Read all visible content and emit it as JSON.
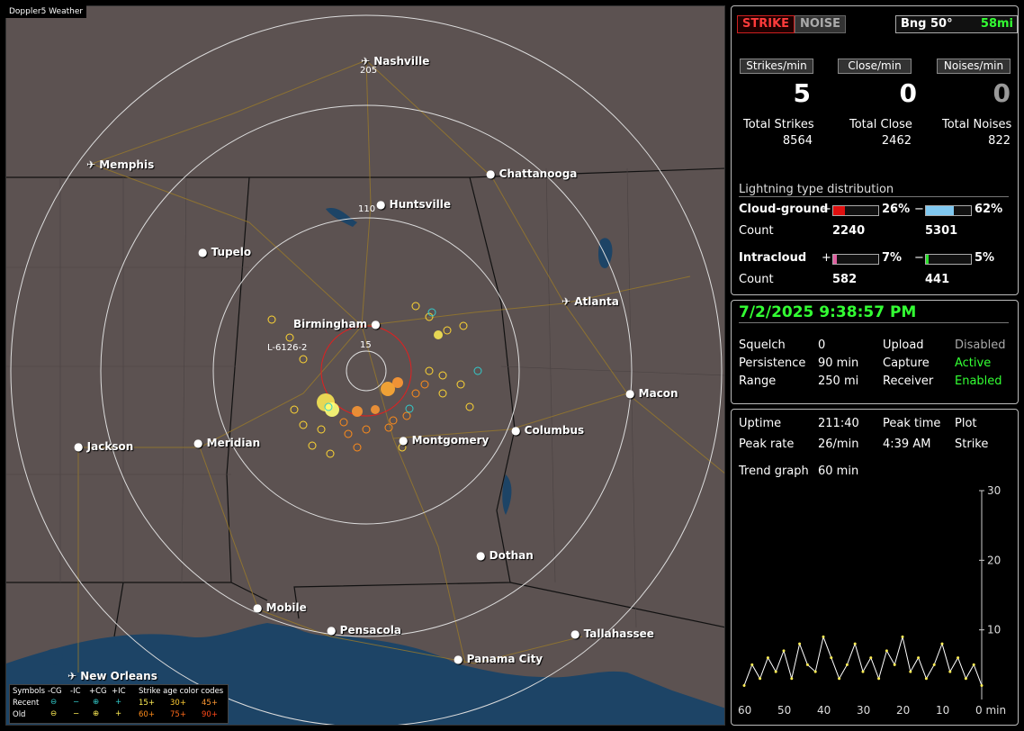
{
  "app_title": "Doppler5 Weather",
  "colors": {
    "map_bg": "#5c5251",
    "water": "#1d4466",
    "accent_green": "#33ff33",
    "strike_red": "#ff3b3b"
  },
  "map": {
    "range_labels": {
      "r205": "205",
      "r110": "110",
      "r15": "15"
    },
    "track_label": "L-6126-2",
    "cities": [
      {
        "name": "Nashville",
        "icon": "airport-icon"
      },
      {
        "name": "Memphis",
        "icon": "airport-icon"
      },
      {
        "name": "Chattanooga",
        "icon": "dot"
      },
      {
        "name": "Huntsville",
        "icon": "dot"
      },
      {
        "name": "Tupelo",
        "icon": "dot"
      },
      {
        "name": "Atlanta",
        "icon": "airport-icon"
      },
      {
        "name": "Birmingham",
        "icon": "dot"
      },
      {
        "name": "Macon",
        "icon": "dot"
      },
      {
        "name": "Columbus",
        "icon": "dot"
      },
      {
        "name": "Jackson",
        "icon": "dot"
      },
      {
        "name": "Meridian",
        "icon": "dot"
      },
      {
        "name": "Montgomery",
        "icon": "dot"
      },
      {
        "name": "Dothan",
        "icon": "dot"
      },
      {
        "name": "Mobile",
        "icon": "dot"
      },
      {
        "name": "Pensacola",
        "icon": "dot"
      },
      {
        "name": "Tallahassee",
        "icon": "dot"
      },
      {
        "name": "Panama City",
        "icon": "dot"
      },
      {
        "name": "New Orleans",
        "icon": "airport-icon"
      }
    ]
  },
  "legend": {
    "symbols_label": "Symbols",
    "cols": [
      "-CG",
      "-IC",
      "+CG",
      "+IC"
    ],
    "age_label": "Strike age color codes",
    "recent_label": "Recent",
    "old_label": "Old",
    "recent_ages": [
      "15+",
      "30+",
      "45+"
    ],
    "old_ages": [
      "60+",
      "75+",
      "90+"
    ]
  },
  "status": {
    "strike_button": "STRIKE",
    "noise_button": "NOISE",
    "bearing": "Bng 50°",
    "distance": "58mi",
    "rate_headers": [
      "Strikes/min",
      "Close/min",
      "Noises/min"
    ],
    "rates": [
      "5",
      "0",
      "0"
    ],
    "total_labels": [
      "Total Strikes",
      "Total Close",
      "Total Noises"
    ],
    "totals": [
      "8564",
      "2462",
      "822"
    ],
    "distribution_title": "Lightning type distribution",
    "cg_label": "Cloud-ground",
    "ic_label": "Intracloud",
    "count_label": "Count",
    "plus": "+",
    "minus": "−",
    "cg_pos_pct": "26%",
    "cg_neg_pct": "62%",
    "cg_pos_fill": 0.26,
    "cg_neg_fill": 0.62,
    "cg_pos_count": "2240",
    "cg_neg_count": "5301",
    "ic_pos_pct": "7%",
    "ic_neg_pct": "5%",
    "ic_pos_fill": 0.07,
    "ic_neg_fill": 0.05,
    "ic_pos_count": "582",
    "ic_neg_count": "441"
  },
  "settings": {
    "datetime": "7/2/2025 9:38:57 PM",
    "squelch_label": "Squelch",
    "squelch": "0",
    "persistence_label": "Persistence",
    "persistence": "90 min",
    "range_label": "Range",
    "range": "250 mi",
    "upload_label": "Upload",
    "upload": "Disabled",
    "capture_label": "Capture",
    "capture": "Active",
    "receiver_label": "Receiver",
    "receiver": "Enabled"
  },
  "stats": {
    "uptime_label": "Uptime",
    "uptime": "211:40",
    "peak_time_label": "Peak time",
    "peak_time": "4:39 AM",
    "plot_label": "Plot",
    "plot": "Strike",
    "peak_rate_label": "Peak rate",
    "peak_rate": "26/min",
    "trend_label": "Trend graph",
    "trend": "60 min"
  },
  "chart_data": {
    "type": "line",
    "x": [
      60,
      58,
      56,
      54,
      52,
      50,
      48,
      46,
      44,
      42,
      40,
      38,
      36,
      34,
      32,
      30,
      28,
      26,
      24,
      22,
      20,
      18,
      16,
      14,
      12,
      10,
      8,
      6,
      4,
      2,
      0
    ],
    "series": [
      {
        "values": [
          2,
          5,
          3,
          6,
          4,
          7,
          3,
          8,
          5,
          4,
          9,
          6,
          3,
          5,
          8,
          4,
          6,
          3,
          7,
          5,
          9,
          4,
          6,
          3,
          5,
          8,
          4,
          6,
          3,
          5,
          2
        ]
      }
    ],
    "ylim": [
      0,
      30
    ],
    "yticks": [
      "30",
      "20",
      "10"
    ],
    "xticks": [
      "60",
      "50",
      "40",
      "30",
      "20",
      "10",
      "0 min"
    ]
  }
}
